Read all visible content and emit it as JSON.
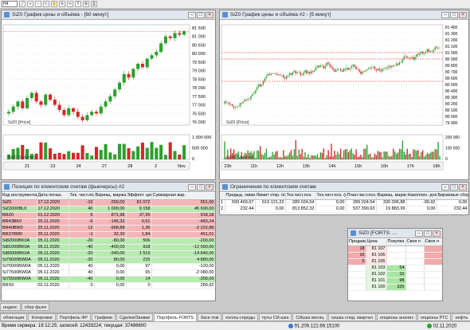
{
  "toolbar": {
    "interval": "H4"
  },
  "chart1": {
    "title": "SiZ0 График цены и объёма - [60 минут]",
    "price_label": "SiZ0 [Price]",
    "volume_label": "SiZ0 [Volume]",
    "price_ticks": [
      "81 500",
      "81 000",
      "80 500",
      "80 000",
      "79 500",
      "79 000",
      "78 500",
      "78 000",
      "77 500",
      "77 000",
      "76 500",
      "76 000"
    ],
    "volume_ticks": [
      "1 000 000",
      "500 000",
      "0"
    ],
    "x_ticks": [
      "21",
      "23",
      "24",
      "27",
      "28",
      "2",
      "Nov"
    ],
    "price_series": [
      76600,
      76900,
      77200,
      76800,
      77400,
      77700,
      77200,
      77000,
      77600,
      77300,
      77000,
      76700,
      76400,
      76800,
      76600,
      76300,
      76100,
      76400,
      76600,
      76500,
      76900,
      77200,
      77500,
      77900,
      78300,
      78800,
      78600,
      79100,
      79400,
      79200,
      79700,
      79900,
      80100,
      80600,
      81000,
      80900,
      81200,
      81100,
      81300
    ]
  },
  "chart2": {
    "title": "SiZ0 График цены и объёма #2 - [5 минут]",
    "price_label": "SiZ0 [Price]",
    "volume_label": "SiZ0 [Volume]",
    "price_ticks": [
      "81 400",
      "81 300",
      "81 200",
      "81 100",
      "81 000",
      "80 900",
      "80 800",
      "80 700",
      "80 600",
      "80 500",
      "80 400",
      "80 300",
      "80 200",
      "80 100",
      "80 000",
      "79 900"
    ],
    "volume_ticks": [
      "200 000",
      "100 000",
      "0"
    ],
    "x_ticks": [
      "23h",
      "11h",
      "12h",
      "13h",
      "14h",
      "15h",
      "16h",
      "17h",
      "18h"
    ]
  },
  "positions": {
    "title": "Позиции по клиентским счетам (фьючерсы) #2",
    "columns": [
      "Код инструмента",
      "Дата погаш.",
      "Тек. чист.поз.",
      "Вариац. маржа",
      "Эффект. цена",
      "Суммарная вар."
    ],
    "rows": [
      {
        "code": "SiZ0",
        "date": "17.12.2020",
        "pos": "-10",
        "var": "-250,00",
        "price": "81 072",
        "sum": "551,00",
        "color": "red"
      },
      {
        "code": "SiZ2000BL0",
        "date": "17.12.2020",
        "pos": "40",
        "var": "1 000,00",
        "price": "9 158",
        "sum": "45 600,00",
        "color": "green"
      },
      {
        "code": "BRZ0",
        "date": "01.12.2020",
        "pos": "6",
        "var": "871,98",
        "price": "37,95",
        "sum": "918,18",
        "color": "red"
      },
      {
        "code": "BR43BK0",
        "date": "25.11.2020",
        "pos": "-6",
        "var": "-145,32",
        "price": "0,51",
        "sum": "-483,24",
        "color": "red"
      },
      {
        "code": "BR40BW0",
        "date": "25.11.2020",
        "pos": "12",
        "var": "-968,88",
        "price": "1,36",
        "sum": "-2 222,88",
        "color": "red"
      },
      {
        "code": "BR378W0",
        "date": "25.11.2020",
        "pos": "-1",
        "var": "32,30",
        "price": "1,84",
        "sum": "451,01",
        "color": "red"
      },
      {
        "code": "Si82000BK0A",
        "date": "05.11.2020",
        "pos": "-20",
        "var": "-80,00",
        "price": "506",
        "sum": "-200,00",
        "color": "green"
      },
      {
        "code": "Si81000BK0A",
        "date": "05.11.2020",
        "pos": "-40",
        "var": "-400,00",
        "price": "918",
        "sum": "-12 560,00",
        "color": "green"
      },
      {
        "code": "Si80000BK0A",
        "date": "05.11.2020",
        "pos": "-20",
        "var": "-340,00",
        "price": "1 519",
        "sum": "-14 840,00",
        "color": "green"
      },
      {
        "code": "Si79000BW0A",
        "date": "05.11.2020",
        "pos": "-20",
        "var": "80,00",
        "price": "215",
        "sum": "4 880,00",
        "color": "green"
      },
      {
        "code": "Si76000BW0A",
        "date": "05.11.2020",
        "pos": "40",
        "var": "0,00",
        "price": "97",
        "sum": "-120,00",
        "color": "white"
      },
      {
        "code": "Si77500BW0A",
        "date": "05.11.2020",
        "pos": "40",
        "var": "0,00",
        "price": "65",
        "sum": "-2 080,00",
        "color": "white"
      },
      {
        "code": "Si75500BW0A",
        "date": "05.11.2020",
        "pos": "-40",
        "var": "0,00",
        "price": "14",
        "sum": "-300,00",
        "color": "green"
      },
      {
        "code": "BRX0",
        "date": "02.11.2020",
        "pos": "0",
        "var": "0,00",
        "price": "0",
        "sum": "289,92",
        "color": "white"
      }
    ]
  },
  "limits": {
    "title": "Ограничения по клиентским счетам",
    "columns": [
      "Предыд. лимит",
      "Лимит откр. поз.",
      "Тек.чист.поз.",
      "Тек.чист.поз. (под заявки)",
      "План.чист.поз.",
      "Вариац. маржа",
      "Накоплен. доход",
      "Биржевые сборы"
    ],
    "rows": [
      [
        "599 469,67",
        "619 121,22",
        "289 024,54",
        "0,00",
        "289 024,54",
        "330 096,88",
        "-99,92",
        "0,00"
      ],
      [
        "232,44",
        "0,00",
        "813 852,32",
        "0,00",
        "537 390,63",
        "19 883,99",
        "0,00",
        "232,44"
      ]
    ],
    "row_nums": [
      "1",
      "2"
    ]
  },
  "orderbook": {
    "title": "SiZ0 [FORTS: ...",
    "columns": [
      "Продажа",
      "Цена",
      "Покупка",
      "Своя п",
      "Своя л"
    ],
    "rows": [
      {
        "sell": "18",
        "price": "81 107",
        "buy": "",
        "side": "sell"
      },
      {
        "sell": "10",
        "price": "81 106",
        "buy": "",
        "side": "sell"
      },
      {
        "sell": "5",
        "price": "81 105",
        "buy": "",
        "side": "sell"
      },
      {
        "sell": "",
        "price": "81 103",
        "buy": "54",
        "side": "buy"
      },
      {
        "sell": "",
        "price": "81 102",
        "buy": "10",
        "side": "buy"
      },
      {
        "sell": "",
        "price": "81 101",
        "buy": "98",
        "side": "buy"
      },
      {
        "sell": "",
        "price": "81 100",
        "buy": "325",
        "side": "buy"
      }
    ]
  },
  "tabs_row1": [
    "индекс",
    "сбер фьюч"
  ],
  "tabs_row2": [
    "облигации",
    "Котировки",
    "Портфель ФР",
    "Графики",
    "Сделки/Заявки",
    "Портфель FORTS",
    "баск-том",
    "коллы-спреды",
    "путы СИ-шка",
    "СИшка месяц",
    "сишка след. квартал",
    "опционы анализ",
    "опционы РТС",
    "нефть"
  ],
  "status": {
    "server_time": "Время сервера: 19:12:25; записей: 12439224; текущая: 37486600",
    "ip": "91.209.122.66:15100",
    "date": "02.11.2020"
  },
  "colors": {
    "up": "#2ca02c",
    "down": "#d62728",
    "sell_bg": "#f4a9a9",
    "buy_bg": "#a8e6a1"
  }
}
